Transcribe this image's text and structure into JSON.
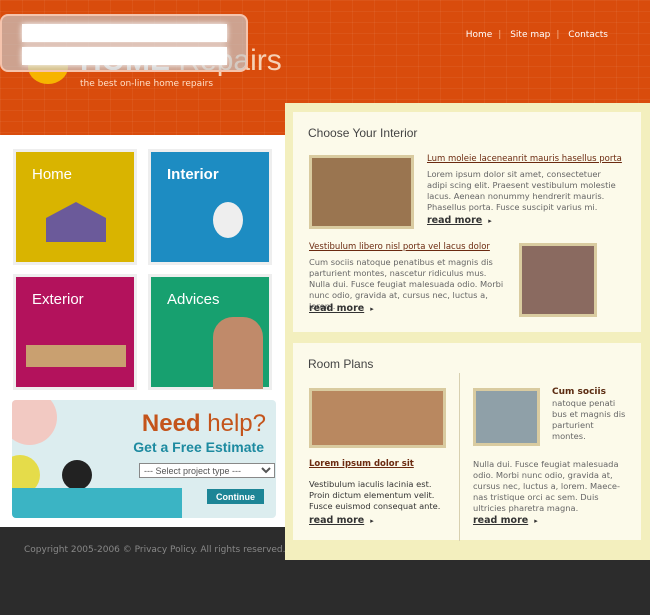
{
  "header": {
    "logo_text_bold": "HOME",
    "logo_text_light": "Repairs",
    "tagline": "the best on-line home repairs",
    "nav": [
      "Home",
      "Site map",
      "Contacts"
    ]
  },
  "tiles": [
    {
      "label": "Home",
      "color": "#d9b400"
    },
    {
      "label": "Interior",
      "color": "#1d8cc2"
    },
    {
      "label": "Exterior",
      "color": "#b3125c"
    },
    {
      "label": "Advices",
      "color": "#17a06f"
    }
  ],
  "help": {
    "need": "Need",
    "help": "help?",
    "estimate": "Get a Free Estimate",
    "select_value": "--- Select project type ---",
    "continue": "Continue"
  },
  "footer": {
    "copyright": "Copyright 2005-2006 © Privacy Policy. All rights reserved."
  },
  "interior": {
    "title": "Choose Your Interior",
    "item1": {
      "link": "Lum moleie laceneanrit mauris hasellus porta",
      "text": "Lorem ipsum dolor sit amet, consectetuer adipi scing elit. Praesent vestibulum molestie lacus. Aenean nonummy hendrerit mauris. Phasellus porta. Fusce suscipit varius mi.",
      "more": "read more"
    },
    "item2": {
      "link": "Vestibulum libero nisl porta vel lacus dolor",
      "text": "Cum sociis natoque penatibus et magnis dis parturient montes, nascetur ridiculus mus. Nulla dui. Fusce feugiat malesuada odio. Morbi nunc odio, gravida at, cursus nec, luctus a, lorem.",
      "more": "read more"
    }
  },
  "plans": {
    "title": "Room Plans",
    "left": {
      "link": "Lorem ipsum dolor sit",
      "text": "Vestibulum iaculis lacinia est. Proin dictum elementum velit. Fusce euismod consequat ante.",
      "more": "read more"
    },
    "right": {
      "heading": "Cum sociis",
      "side_text": "natoque penati bus et magnis dis parturient montes.",
      "text": "Nulla dui. Fusce feugiat malesuada odio. Morbi nunc odio, gravida at, cursus nec, luctus a, lorem. Maece-nas tristique orci ac sem. Duis ultricies pharetra magna.",
      "more": "read more"
    }
  }
}
